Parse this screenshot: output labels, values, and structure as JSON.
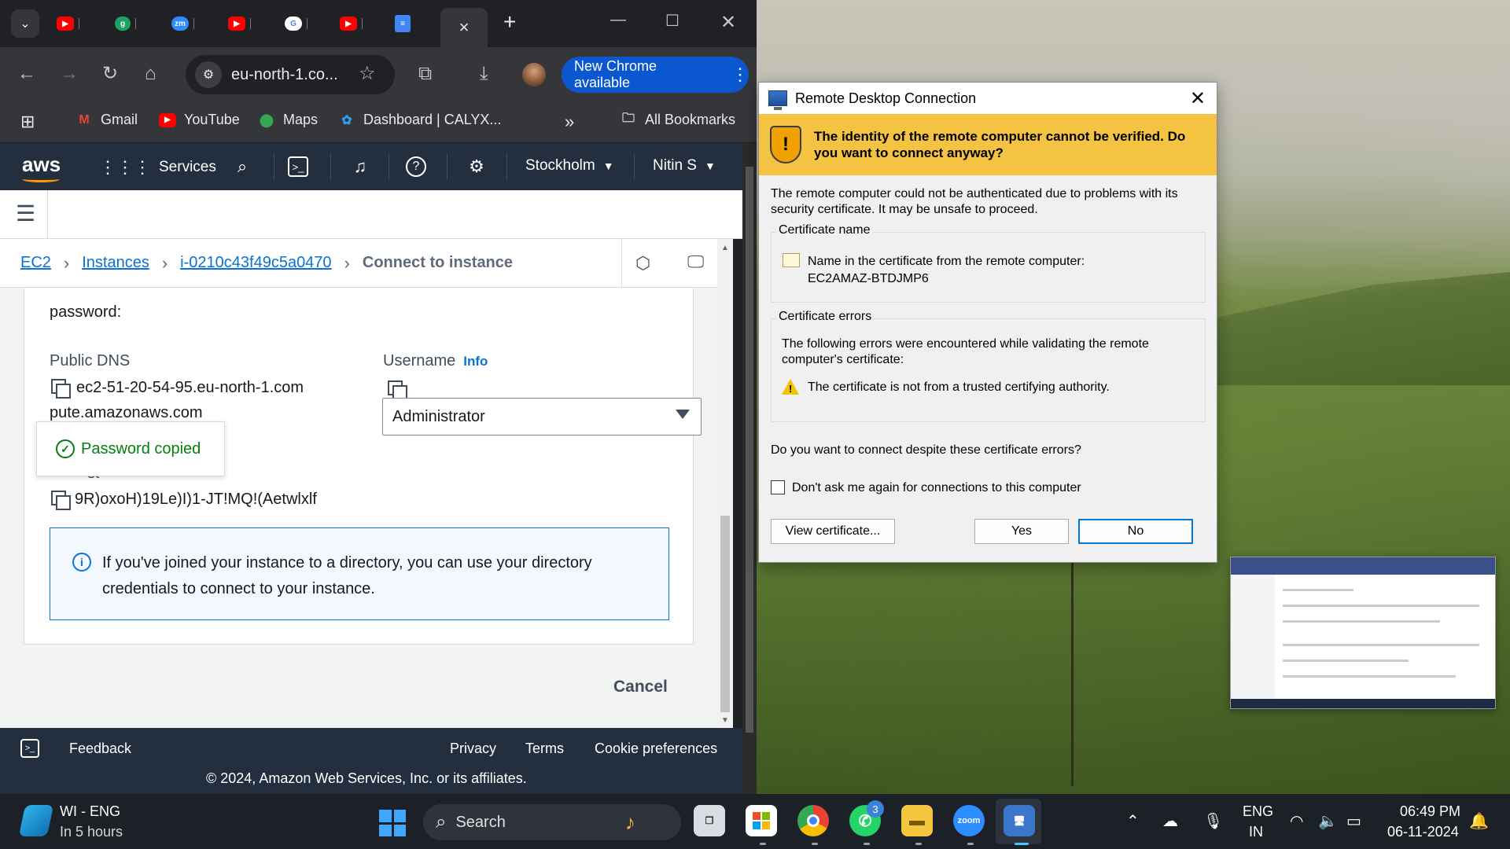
{
  "chrome": {
    "tabs": [
      {
        "icon": "youtube-icon",
        "color": "#ff0000"
      },
      {
        "icon": "g-icon",
        "color": "#1ea362"
      },
      {
        "icon": "zoom-icon",
        "color": "#2d8cff"
      },
      {
        "icon": "youtube-icon",
        "color": "#ff0000"
      },
      {
        "icon": "google-icon",
        "color": "#4285f4"
      },
      {
        "icon": "youtube-icon",
        "color": "#ff0000"
      },
      {
        "icon": "docs-icon",
        "color": "#4285f4"
      }
    ],
    "active_tab_close": "×",
    "new_tab": "+",
    "url": "eu-north-1.co...",
    "new_chrome_label": "New Chrome available",
    "bookmarks": [
      {
        "label": "Gmail",
        "icon": "gmail-icon"
      },
      {
        "label": "YouTube",
        "icon": "youtube-icon"
      },
      {
        "label": "Maps",
        "icon": "maps-icon"
      },
      {
        "label": "Dashboard | CALYX...",
        "icon": "calyx-icon"
      }
    ],
    "more_bookmarks": "»",
    "all_bookmarks": "All Bookmarks"
  },
  "aws": {
    "logo": "aws",
    "services": "Services",
    "region": "Stockholm",
    "user": "Nitin S",
    "breadcrumb": {
      "ec2": "EC2",
      "instances": "Instances",
      "instance_id": "i-0210c43f49c5a0470",
      "current": "Connect to instance"
    },
    "password_intro": "password:",
    "public_dns_label": "Public DNS",
    "public_dns_line1": "ec2-51-20-54-95.eu-north-1.com",
    "public_dns_line2": "pute.amazonaws.com",
    "username_label": "Username",
    "info_link": "Info",
    "username_value": "Administrator",
    "toast": "Password copied",
    "password_label_fragment": "ssword",
    "password_value": "9R)oxoH)19Le)I)1-JT!MQ!(Aetwlxlf",
    "info_text_line1": "If you've joined your instance to a directory, you can use your directory",
    "info_text_line2": "credentials to connect to your instance.",
    "cancel": "Cancel",
    "footer": {
      "feedback": "Feedback",
      "privacy": "Privacy",
      "terms": "Terms",
      "cookie": "Cookie preferences",
      "copyright": "© 2024, Amazon Web Services, Inc. or its affiliates."
    }
  },
  "rdp": {
    "title": "Remote Desktop Connection",
    "warning_line1": "The identity of the remote computer cannot be verified. Do",
    "warning_line2": "you want to connect anyway?",
    "intro_line1": "The remote computer could not be authenticated due to problems with its",
    "intro_line2": "security certificate. It may be unsafe to proceed.",
    "cert_name_title": "Certificate name",
    "cert_name_line1": "Name in the certificate from the remote computer:",
    "cert_name_value": "EC2AMAZ-BTDJMP6",
    "cert_errors_title": "Certificate errors",
    "cert_errors_line1": "The following errors were encountered while validating the remote",
    "cert_errors_line2": "computer's certificate:",
    "cert_error_item": "The certificate is not from a trusted certifying authority.",
    "question": "Do you want to connect despite these certificate errors?",
    "dont_ask": "Don't ask me again for connections to this computer",
    "dont_ask_checked": false,
    "view_cert": "View certificate...",
    "yes": "Yes",
    "no": "No"
  },
  "taskbar": {
    "weather_title": "WI - ENG",
    "weather_sub": "In 5 hours",
    "search": "Search",
    "whatsapp_badge": "3",
    "zoom_label": "zoom",
    "lang_line1": "ENG",
    "lang_line2": "IN",
    "time": "06:49 PM",
    "date": "06-11-2024"
  }
}
